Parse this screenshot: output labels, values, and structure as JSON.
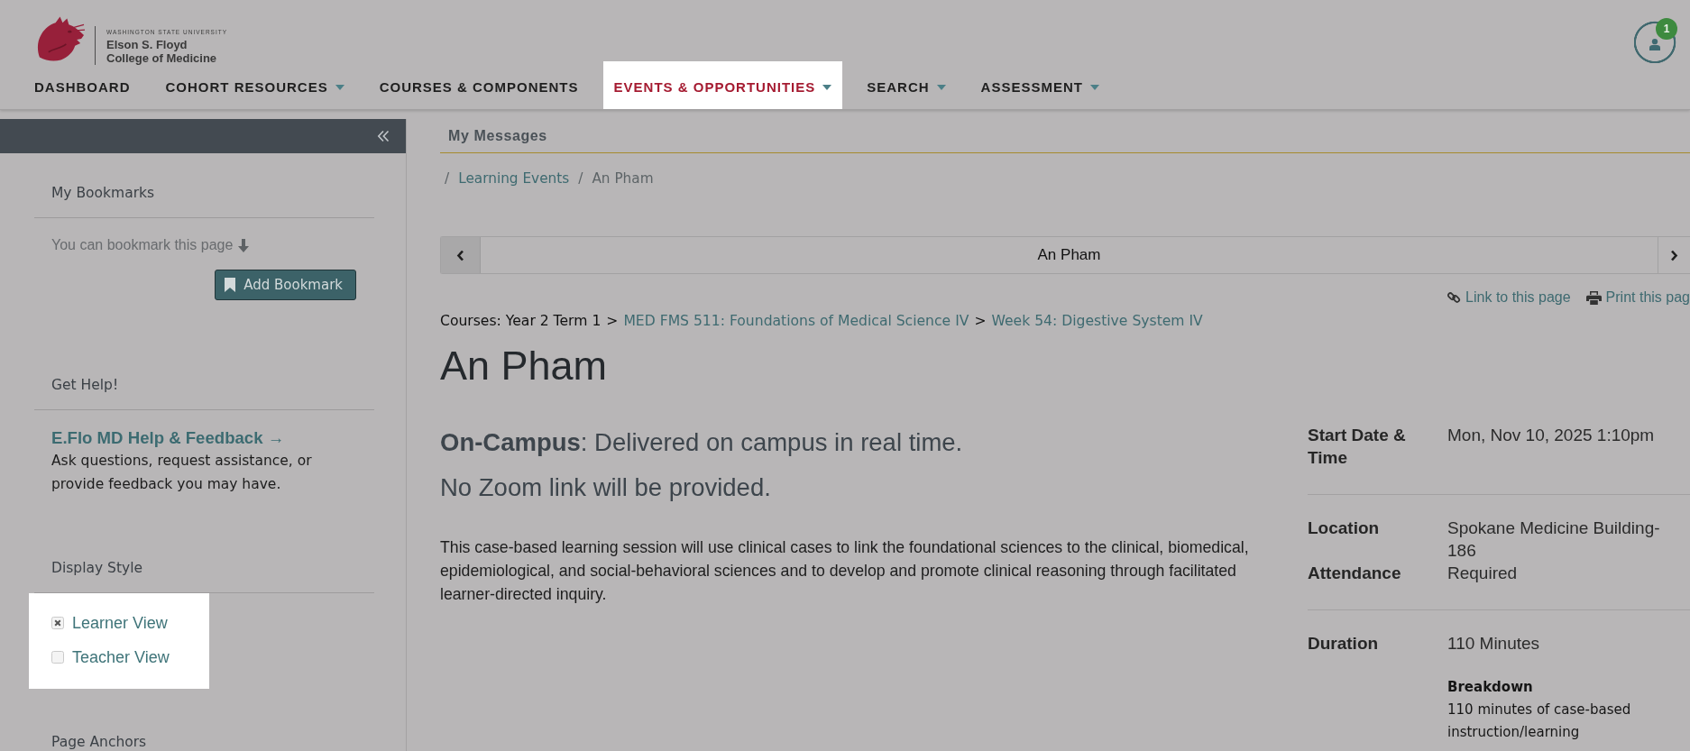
{
  "header": {
    "logo": {
      "caption": "WASHINGTON STATE UNIVERSITY",
      "title_lines": [
        "Elson S. Floyd",
        "College of Medicine"
      ]
    },
    "nav": [
      {
        "label": "DASHBOARD",
        "dropdown": false,
        "selected": false,
        "spotlight": false
      },
      {
        "label": "COHORT RESOURCES",
        "dropdown": true,
        "selected": false,
        "spotlight": false
      },
      {
        "label": "COURSES & COMPONENTS",
        "dropdown": false,
        "selected": false,
        "spotlight": false
      },
      {
        "label": "EVENTS & OPPORTUNITIES",
        "dropdown": true,
        "selected": true,
        "spotlight": true
      },
      {
        "label": "SEARCH",
        "dropdown": true,
        "selected": false,
        "spotlight": false
      },
      {
        "label": "ASSESSMENT",
        "dropdown": true,
        "selected": false,
        "spotlight": false
      }
    ],
    "account": {
      "badge": "1"
    }
  },
  "sidebar": {
    "sections": [
      {
        "kind": "bookmarks",
        "title": "My Bookmarks",
        "hint": "You can bookmark this page",
        "button": "Add Bookmark"
      },
      {
        "kind": "help",
        "title": "Get Help!",
        "link": "E.Flo MD Help & Feedback →",
        "text": "Ask questions, request assistance, or provide feedback you may have."
      },
      {
        "kind": "options",
        "title": "Display Style",
        "spotlight": true,
        "options": [
          {
            "label": "Learner View",
            "checked": true
          },
          {
            "label": "Teacher View",
            "checked": false
          }
        ]
      },
      {
        "kind": "heading",
        "title": "Page Anchors"
      }
    ]
  },
  "main": {
    "tab": "My Messages",
    "breadcrumb": [
      {
        "kind": "separator",
        "text": "/"
      },
      {
        "kind": "link",
        "text": "Learning Events"
      },
      {
        "kind": "separator",
        "text": "/"
      },
      {
        "kind": "current",
        "text": "An Pham"
      }
    ],
    "pager": {
      "title": "An Pham"
    },
    "actions": [
      {
        "kind": "link",
        "label": "Link to this page"
      },
      {
        "kind": "print",
        "label": "Print this pag"
      }
    ],
    "course_path": [
      {
        "kind": "text",
        "text": "Courses: Year 2 Term 1"
      },
      {
        "kind": "separator",
        "text": ">"
      },
      {
        "kind": "link",
        "text": "MED FMS 511: Foundations of Medical Science IV"
      },
      {
        "kind": "separator",
        "text": ">"
      },
      {
        "kind": "link",
        "text": "Week 54: Digestive System IV"
      }
    ],
    "title": "An Pham",
    "delivery": "**On-Campus**: Delivered on campus in real time.",
    "zoom_note": "No Zoom link will be provided.",
    "description": "This case-based learning session will use clinical cases to link the foundational sciences to the clinical, biomedical, epidemiological, and social-behavioral sciences and to develop and promote clinical reasoning through facilitated learner-directed inquiry.",
    "details": [
      {
        "rows": [
          {
            "label": "Start Date & Time",
            "value": "Mon, Nov 10, 2025 1:10pm"
          }
        ]
      },
      {
        "rows": [
          {
            "label": "Location",
            "value": "Spokane Medicine Building-186"
          },
          {
            "label": "Attendance",
            "value": "Required"
          }
        ]
      },
      {
        "rows": [
          {
            "label": "Duration",
            "value": "110 Minutes",
            "breakdown": {
              "title": "Breakdown",
              "text": "110 minutes of case-based instruction/learning"
            }
          }
        ]
      }
    ]
  }
}
